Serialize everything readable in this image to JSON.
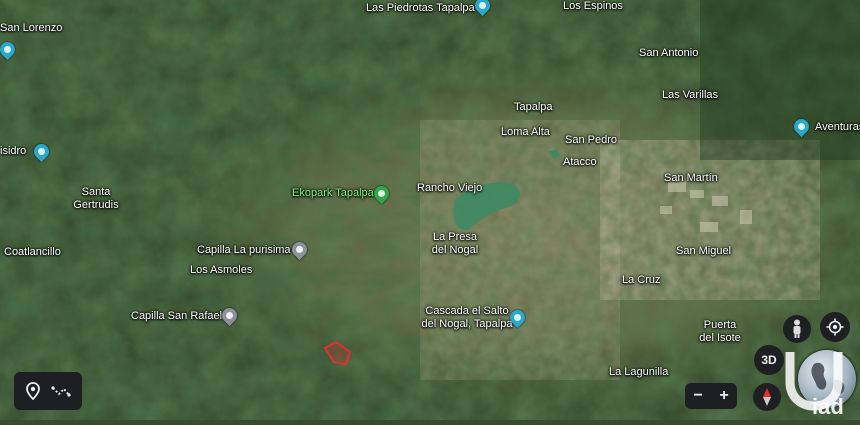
{
  "places": [
    {
      "id": "las-piedrotas-tapalpa",
      "text": "Las Piedrotas Tapalpa"
    },
    {
      "id": "los-espinos",
      "text": "Los Espinos"
    },
    {
      "id": "san-lorenzo",
      "text": "San Lorenzo"
    },
    {
      "id": "san-antonio",
      "text": "San Antonio"
    },
    {
      "id": "las-varillas",
      "text": "Las Varillas"
    },
    {
      "id": "tapalpa",
      "text": "Tapalpa"
    },
    {
      "id": "loma-alta",
      "text": "Loma Alta"
    },
    {
      "id": "san-pedro",
      "text": "San Pedro"
    },
    {
      "id": "aventuras",
      "text": "Aventuras"
    },
    {
      "id": "isidro",
      "text": "isidro"
    },
    {
      "id": "atacco",
      "text": "Atacco"
    },
    {
      "id": "santa-gertrudis",
      "text": "Santa\nGertrudis"
    },
    {
      "id": "ekopark-tapalpa",
      "text": "Ekopark Tapalpa"
    },
    {
      "id": "rancho-viejo",
      "text": "Rancho Viejo"
    },
    {
      "id": "san-martin",
      "text": "San Martín"
    },
    {
      "id": "coatlancillo",
      "text": "Coatlancillo"
    },
    {
      "id": "capilla-la-purisima",
      "text": "Capilla La purisima"
    },
    {
      "id": "la-presa-del-nogal",
      "text": "La Presa\ndel Nogal"
    },
    {
      "id": "san-miguel",
      "text": "San Miguel"
    },
    {
      "id": "los-asmoles",
      "text": "Los Asmoles"
    },
    {
      "id": "la-cruz",
      "text": "La Cruz"
    },
    {
      "id": "capilla-san-rafael",
      "text": "Capilla San Rafael"
    },
    {
      "id": "cascada-el-salto",
      "text": "Cascada el Salto\ndel Nogal, Tapalpa"
    },
    {
      "id": "puerta-del-isote",
      "text": "Puerta\ndel Isote"
    },
    {
      "id": "la-lagunilla",
      "text": "La Lagunilla"
    }
  ],
  "controls": {
    "three_d": "3D",
    "zoom_out": "−",
    "zoom_in": "+",
    "watermark": "iad"
  },
  "colors": {
    "poi_blue": "#2aa8c9",
    "poi_green": "#2ea84a",
    "parcel_outline": "#e03030",
    "lake": "#3f8a63"
  }
}
